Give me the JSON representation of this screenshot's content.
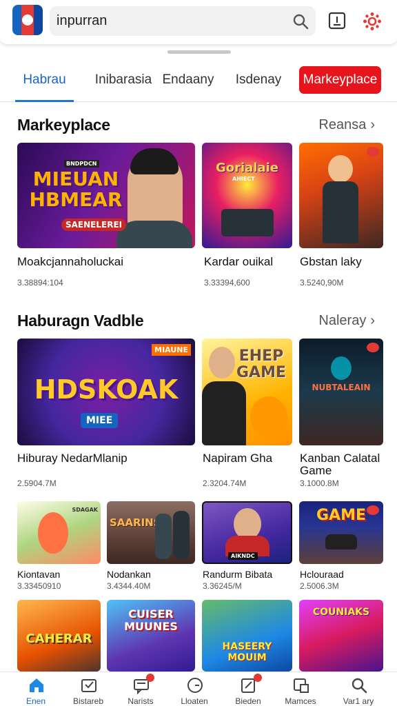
{
  "search": {
    "value": "inpurran"
  },
  "tabs": [
    {
      "label": "Habrau",
      "active": true
    },
    {
      "label": "Inibarasia"
    },
    {
      "label": "Endaany"
    },
    {
      "label": "Isdenay"
    },
    {
      "label": "Markeyplace",
      "highlighted": true
    }
  ],
  "sections": [
    {
      "title": "Markeyplace",
      "more": "Reansa",
      "cards": [
        {
          "thumb_text": "MIEUAN HBMEAR",
          "thumb_subtext": "SAENELEREI",
          "thumb_tag": "BNDPDCN",
          "title": "Moakcjannaholuckai",
          "sub": "3.38894:104"
        },
        {
          "thumb_text": "Gorialaie",
          "thumb_subtext": "AHIECT",
          "title": "Kardar ouikal",
          "sub": "3.33394,600"
        },
        {
          "thumb_text": "",
          "title": "Gbstan laky",
          "sub": "3.5240,90M"
        }
      ]
    },
    {
      "title": "Haburagn Vadble",
      "more": "Naleray",
      "cards": [
        {
          "thumb_text": "HDSKOAK",
          "thumb_tag": "MIAUNE",
          "thumb_subtext": "MIEE",
          "title": "Hiburay NedarMlanip",
          "sub": "2.5904.7M"
        },
        {
          "thumb_text": "EHEP GAME",
          "title": "Napiram Gha",
          "sub": "2.3204.74M"
        },
        {
          "thumb_text": "NUBTALEAIN",
          "title": "Kanban Calatal Game",
          "sub": "3.1000.8M"
        }
      ]
    },
    {
      "cards": [
        {
          "thumb_text": "",
          "thumb_tag": "SDAGAK",
          "title": "Kiontavan",
          "sub": "3.33450910"
        },
        {
          "thumb_text": "SAARINS",
          "title": "Nodankan",
          "sub": "3.4344.40M"
        },
        {
          "thumb_text": "AIKNDC",
          "title": "Randurm Bibata",
          "sub": "3.36245/M"
        },
        {
          "thumb_text": "GAME",
          "title": "Hclouraad",
          "sub": "2.5006.3M"
        }
      ]
    },
    {
      "cards": [
        {
          "thumb_text": "CAHERAR"
        },
        {
          "thumb_text": "CUISER MUUNES"
        },
        {
          "thumb_text": "HASEERY MOUIM"
        },
        {
          "thumb_text": "COUNIAKS"
        }
      ]
    }
  ],
  "bottom_nav": [
    {
      "label": "Enen",
      "icon": "home-icon",
      "active": true
    },
    {
      "label": "Bistareb",
      "icon": "box-icon"
    },
    {
      "label": "Narists",
      "icon": "chat-icon",
      "badge": true
    },
    {
      "label": "Lloaten",
      "icon": "clock-icon"
    },
    {
      "label": "Bieden",
      "icon": "edit-icon",
      "badge": true
    },
    {
      "label": "Mamces",
      "icon": "library-icon"
    },
    {
      "label": "Var1 ary",
      "icon": "search-icon"
    }
  ],
  "colors": {
    "accent": "#1976d2",
    "highlight": "#e8141c"
  }
}
